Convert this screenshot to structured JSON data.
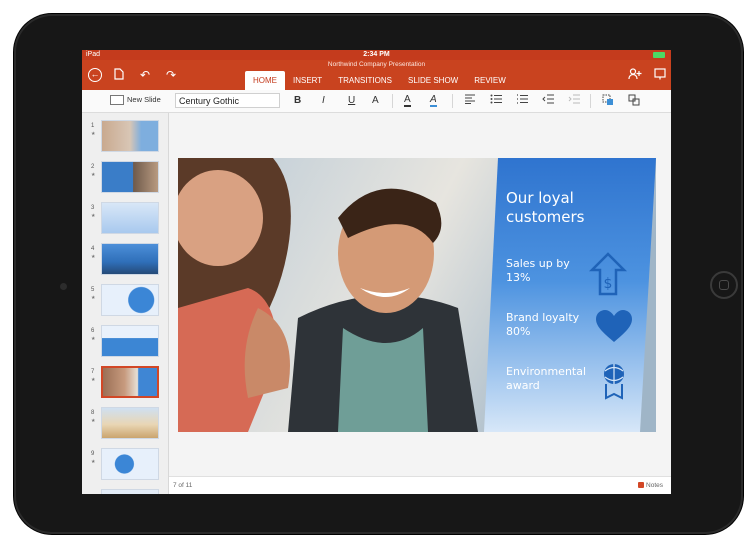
{
  "status": {
    "device": "iPad",
    "time": "2:34 PM"
  },
  "document": {
    "title": "Northwind Company Presentation"
  },
  "ribbon": {
    "tabs": [
      {
        "label": "HOME"
      },
      {
        "label": "INSERT"
      },
      {
        "label": "TRANSITIONS"
      },
      {
        "label": "SLIDE SHOW"
      },
      {
        "label": "REVIEW"
      }
    ],
    "active_tab": "HOME"
  },
  "toolbar": {
    "new_slide_label": "New Slide",
    "font_name": "Century Gothic",
    "bold_glyph": "B",
    "italic_glyph": "I",
    "underline_glyph": "U",
    "text_effects_glyph": "A",
    "font_color_glyph": "A",
    "highlight_glyph": "A"
  },
  "thumbnails": [
    {
      "number": "1",
      "badge": "★"
    },
    {
      "number": "2",
      "badge": "★"
    },
    {
      "number": "3",
      "badge": "★"
    },
    {
      "number": "4",
      "badge": "★"
    },
    {
      "number": "5",
      "badge": "★"
    },
    {
      "number": "6",
      "badge": "★"
    },
    {
      "number": "7",
      "badge": "★"
    },
    {
      "number": "8",
      "badge": "★"
    },
    {
      "number": "9",
      "badge": "★"
    }
  ],
  "selected_slide": 7,
  "footer": {
    "slide_count": "7 of 11",
    "notes_label": "Notes"
  },
  "slide": {
    "heading_line1": "Our loyal",
    "heading_line2": "customers",
    "item1_line1": "Sales up by",
    "item1_line2": "13%",
    "item2_line1": "Brand loyalty",
    "item2_line2": "80%",
    "item3_line1": "Environmental",
    "item3_line2": "award"
  },
  "colors": {
    "brand": "#c9431f",
    "active_tab_text": "#c43b1d",
    "slide_panel": "#3f86d4",
    "selected_thumb_border": "#d24726"
  }
}
